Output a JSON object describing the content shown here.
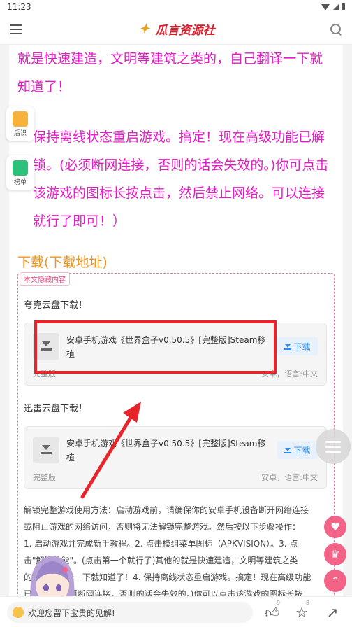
{
  "status_bar": {
    "time": "11:23"
  },
  "header": {
    "logo_text": "瓜言资源社",
    "logo_mark": "✦"
  },
  "article": {
    "para1": "就是快速建造，文明等建筑之类的，自己翻译一下就知道了！",
    "para2": "保持离线状态重启游戏。搞定！现在高级功能已解锁。(必须断网连接，否则的话会失效的。)你可点击该游戏的图标长按点击，然后禁止网络。可以连接就行了即可！）",
    "download_heading": "下载(下载地址)"
  },
  "hidden_section": {
    "tag": "本文隐藏内容",
    "downloads": [
      {
        "label": "夸克云盘下载！",
        "name": "安卓手机游戏《世界盒子v0.50.5》[完整版]Steam移植",
        "button": "下载",
        "edition": "完整版",
        "meta": "安卓，语言:中文"
      },
      {
        "label": "迅雷云盘下载！",
        "name": "安卓手机游戏《世界盒子v0.50.5》[完整版]Steam移植",
        "button": "下载",
        "edition": "完整版",
        "meta": "安卓，语言:中文"
      }
    ],
    "instructions": [
      "解锁完整游戏使用方法：启动游戏前，请确保你的安卓手机设备断开网络连接",
      "或阻止游戏的网络访问，否则将无法解锁完整游戏。然后按以下步骤操作：",
      "1. 启动游戏并完成新手教程。2. 点击模组菜单图标（APKVISION）。3. 点",
      "击\"解锁功能\"。(点击第一个就行了)其他的就是快速建造，文明等建筑之类",
      "的，自己翻译一下就知道了！4. 保持离线状态重启游戏。搞定！现在高级功能",
      "已解锁。(必须断网连接，否则的话会失效的。)你可以点击该游戏的图标长按"
    ]
  },
  "side_buttons": [
    {
      "label": "后识",
      "color": "#f7b23b"
    },
    {
      "label": "榜单",
      "color": "#2fc07a"
    }
  ],
  "bottom_bar": {
    "comment_placeholder": "欢迎您留下宝贵的见解!",
    "like_count": "9",
    "fav_count": "8"
  },
  "colors": {
    "magenta_text": "#e51bc6",
    "orange_heading": "#f09419",
    "annotation_red": "#e8242b",
    "accent_pink": "#f26387"
  }
}
